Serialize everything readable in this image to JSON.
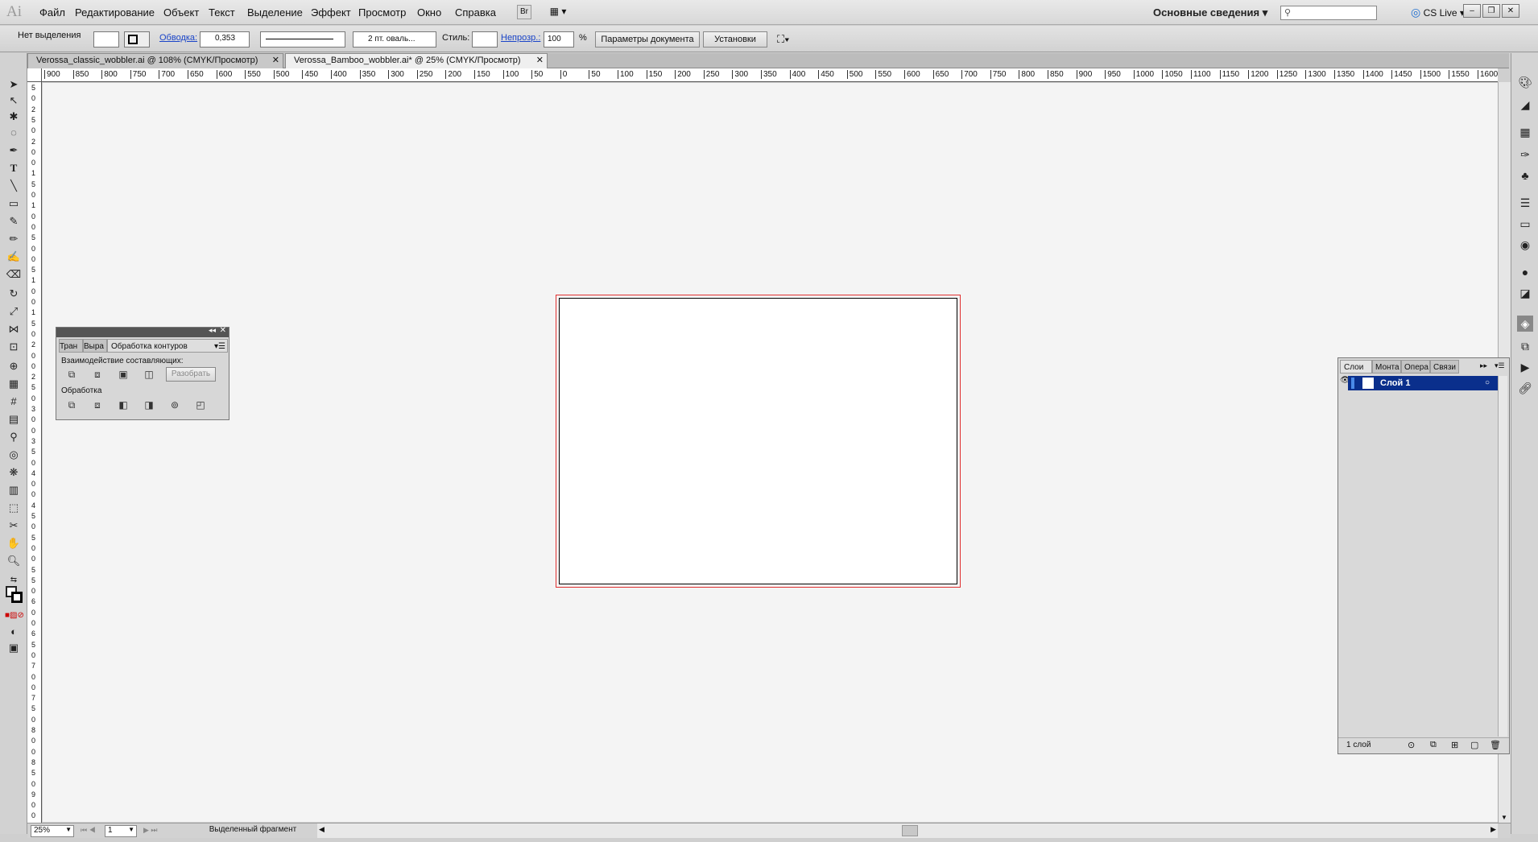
{
  "app": {
    "logo": "Ai"
  },
  "menu": [
    "Файл",
    "Редактирование",
    "Объект",
    "Текст",
    "Выделение",
    "Эффект",
    "Просмотр",
    "Окно",
    "Справка"
  ],
  "menubar_buttons": {
    "bridge": "Br",
    "arrange": "▦ ▾"
  },
  "workspace": "Основные сведения",
  "cs_live": "CS Live",
  "window_buttons": [
    "–",
    "❐",
    "✕"
  ],
  "control": {
    "selection": "Нет выделения",
    "stroke_link": "Обводка:",
    "stroke_value": "0,353",
    "brush": "2 пт. оваль...",
    "style_label": "Стиль:",
    "opacity_link": "Непрозр.:",
    "opacity_value": "100",
    "opacity_unit": "%",
    "doc_params": "Параметры документа",
    "settings": "Установки"
  },
  "tabs": [
    {
      "label": "Verossa_classic_wobbler.ai @ 108% (CMYK/Просмотр)",
      "active": false
    },
    {
      "label": "Verossa_Bamboo_wobbler.ai* @ 25% (CMYK/Просмотр)",
      "active": true
    }
  ],
  "ruler_h": [
    "900",
    "850",
    "800",
    "750",
    "700",
    "650",
    "600",
    "550",
    "500",
    "450",
    "400",
    "350",
    "300",
    "250",
    "200",
    "150",
    "100",
    "50",
    "0",
    "50",
    "100",
    "150",
    "200",
    "250",
    "300",
    "350",
    "400",
    "450",
    "500",
    "550",
    "600",
    "650",
    "700",
    "750",
    "800",
    "850",
    "900",
    "950",
    "1000",
    "1050",
    "1100",
    "1150",
    "1200",
    "1250",
    "1300",
    "1350",
    "1400",
    "1450",
    "1500",
    "1550",
    "1600"
  ],
  "ruler_v": [
    "5",
    "0",
    "2",
    "5",
    "0",
    "2",
    "0",
    "0",
    "1",
    "5",
    "0",
    "1",
    "0",
    "0",
    "5",
    "0",
    "0",
    "5",
    "1",
    "0",
    "0",
    "1",
    "5",
    "0",
    "2",
    "0",
    "0",
    "2",
    "5",
    "0",
    "3",
    "0",
    "0",
    "3",
    "5",
    "0",
    "4",
    "0",
    "0",
    "4",
    "5",
    "0",
    "5",
    "0",
    "0",
    "5",
    "5",
    "0",
    "6",
    "0",
    "0",
    "6",
    "5",
    "0",
    "7",
    "0",
    "0",
    "7",
    "5",
    "0",
    "8",
    "0",
    "0",
    "8",
    "5",
    "0",
    "9",
    "0",
    "0"
  ],
  "pathfinder": {
    "tabs": [
      "Тран",
      "Выра",
      "Обработка контуров"
    ],
    "shape_modes": "Взаимодействие составляющих:",
    "expand": "Разобрать",
    "pathfinders": "Обработка"
  },
  "layers": {
    "tabs": [
      "Слои",
      "Монта",
      "Опера",
      "Связи"
    ],
    "layer_name": "Слой 1",
    "count": "1 слой"
  },
  "status": {
    "zoom": "25%",
    "page": "1",
    "info": "Выделенный фрагмент"
  },
  "colors": {
    "accent": "#0a2f8c",
    "bleed": "#e03030",
    "link": "#1a44c8"
  }
}
